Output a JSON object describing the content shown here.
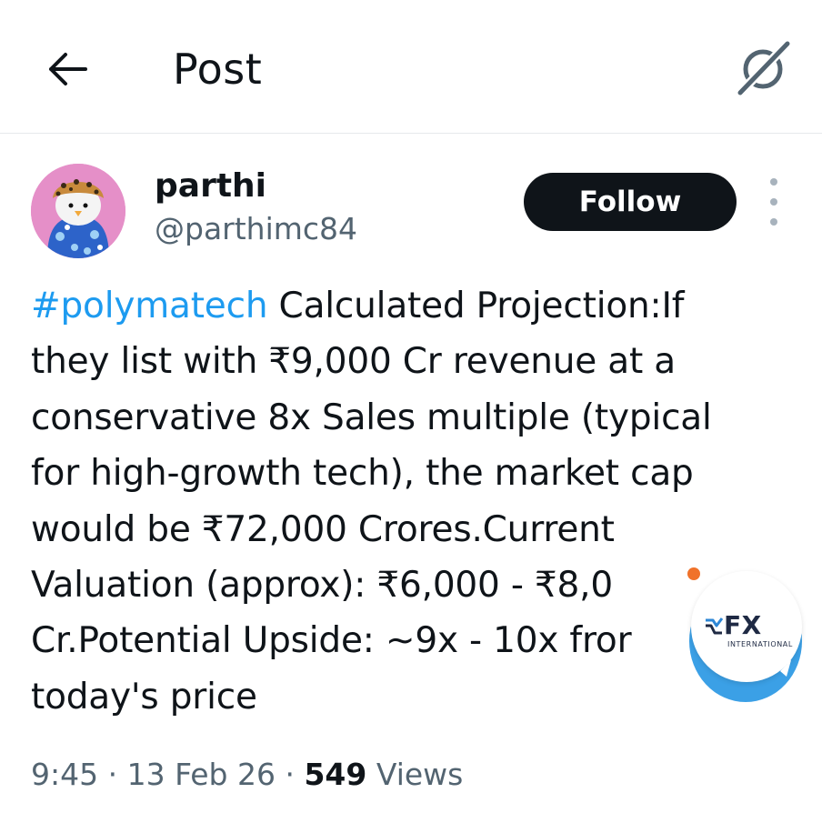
{
  "header": {
    "title": "Post",
    "back_icon": "arrow-left-icon",
    "grok_icon": "grok-icon"
  },
  "author": {
    "name": "parthi",
    "handle": "@parthimc84",
    "follow_label": "Follow",
    "more_icon": "more-vertical-icon"
  },
  "post": {
    "hashtag": "#polymatech",
    "lines": [
      " Calculated Projection:If",
      "they list with ₹9,000 Cr revenue at a",
      "conservative 8x Sales multiple (typical",
      "for high-growth tech), the market cap",
      "would be ₹72,000 Crores.Current",
      "Valuation (approx): ₹6,000 - ₹8,0",
      "Cr.Potential Upside: ~9x - 10x fror",
      "today's price"
    ]
  },
  "meta": {
    "time": "9:45",
    "sep1": " · ",
    "date": "13 Feb 26",
    "sep2": " · ",
    "views_count": "549",
    "views_label": " Views"
  },
  "fx_widget": {
    "brand": "FX",
    "subtitle": "INTERNATIONAL",
    "send_icon": "telegram-icon"
  },
  "colors": {
    "text": "#0f1419",
    "secondary": "#536471",
    "link": "#1d9bf0",
    "follow_bg": "#0f1419",
    "fx_ring": "#3ba0e6",
    "fx_dot": "#f0722a"
  }
}
